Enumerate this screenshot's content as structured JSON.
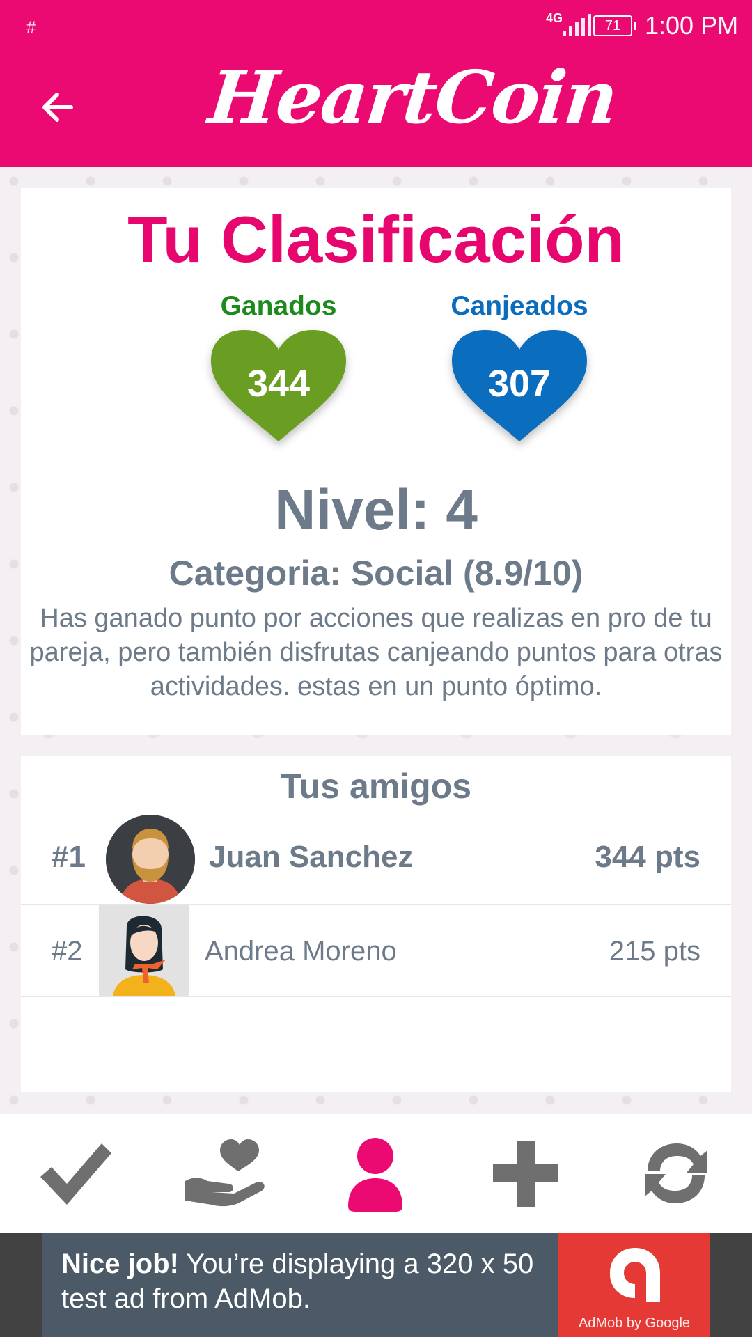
{
  "status_bar": {
    "notification": "#",
    "network": "4G",
    "battery": "71",
    "time": "1:00 PM"
  },
  "header": {
    "app_title": "HeartCoin"
  },
  "ranking": {
    "title": "Tu Clasificación",
    "earned_label": "Ganados",
    "earned_value": "344",
    "redeemed_label": "Canjeados",
    "redeemed_value": "307",
    "level": "Nivel: 4",
    "category": "Categoria: Social (8.9/10)",
    "description": "Has ganado punto por acciones que realizas en pro de tu pareja, pero también disfrutas canjeando puntos para otras actividades. estas en un punto óptimo."
  },
  "friends": {
    "title": "Tus amigos",
    "rows": [
      {
        "rank": "#1",
        "name": "Juan Sanchez",
        "points": "344 pts"
      },
      {
        "rank": "#2",
        "name": "Andrea Moreno",
        "points": "215 pts"
      }
    ]
  },
  "bottom_nav": {
    "items": [
      "check-icon",
      "give-heart-icon",
      "profile-icon",
      "plus-icon",
      "sync-icon"
    ],
    "active": "profile-icon",
    "active_color": "#ea0a72",
    "inactive_color": "#6f6f6f"
  },
  "ad": {
    "headline": "Nice job!",
    "body": " You’re displaying a 320 x 50 test ad from AdMob.",
    "logo_caption": "AdMob by Google"
  },
  "colors": {
    "brand": "#ea0a72",
    "earned": "#6a9e23",
    "redeemed": "#0b6dbd",
    "text_gray": "#6c7a8a"
  }
}
